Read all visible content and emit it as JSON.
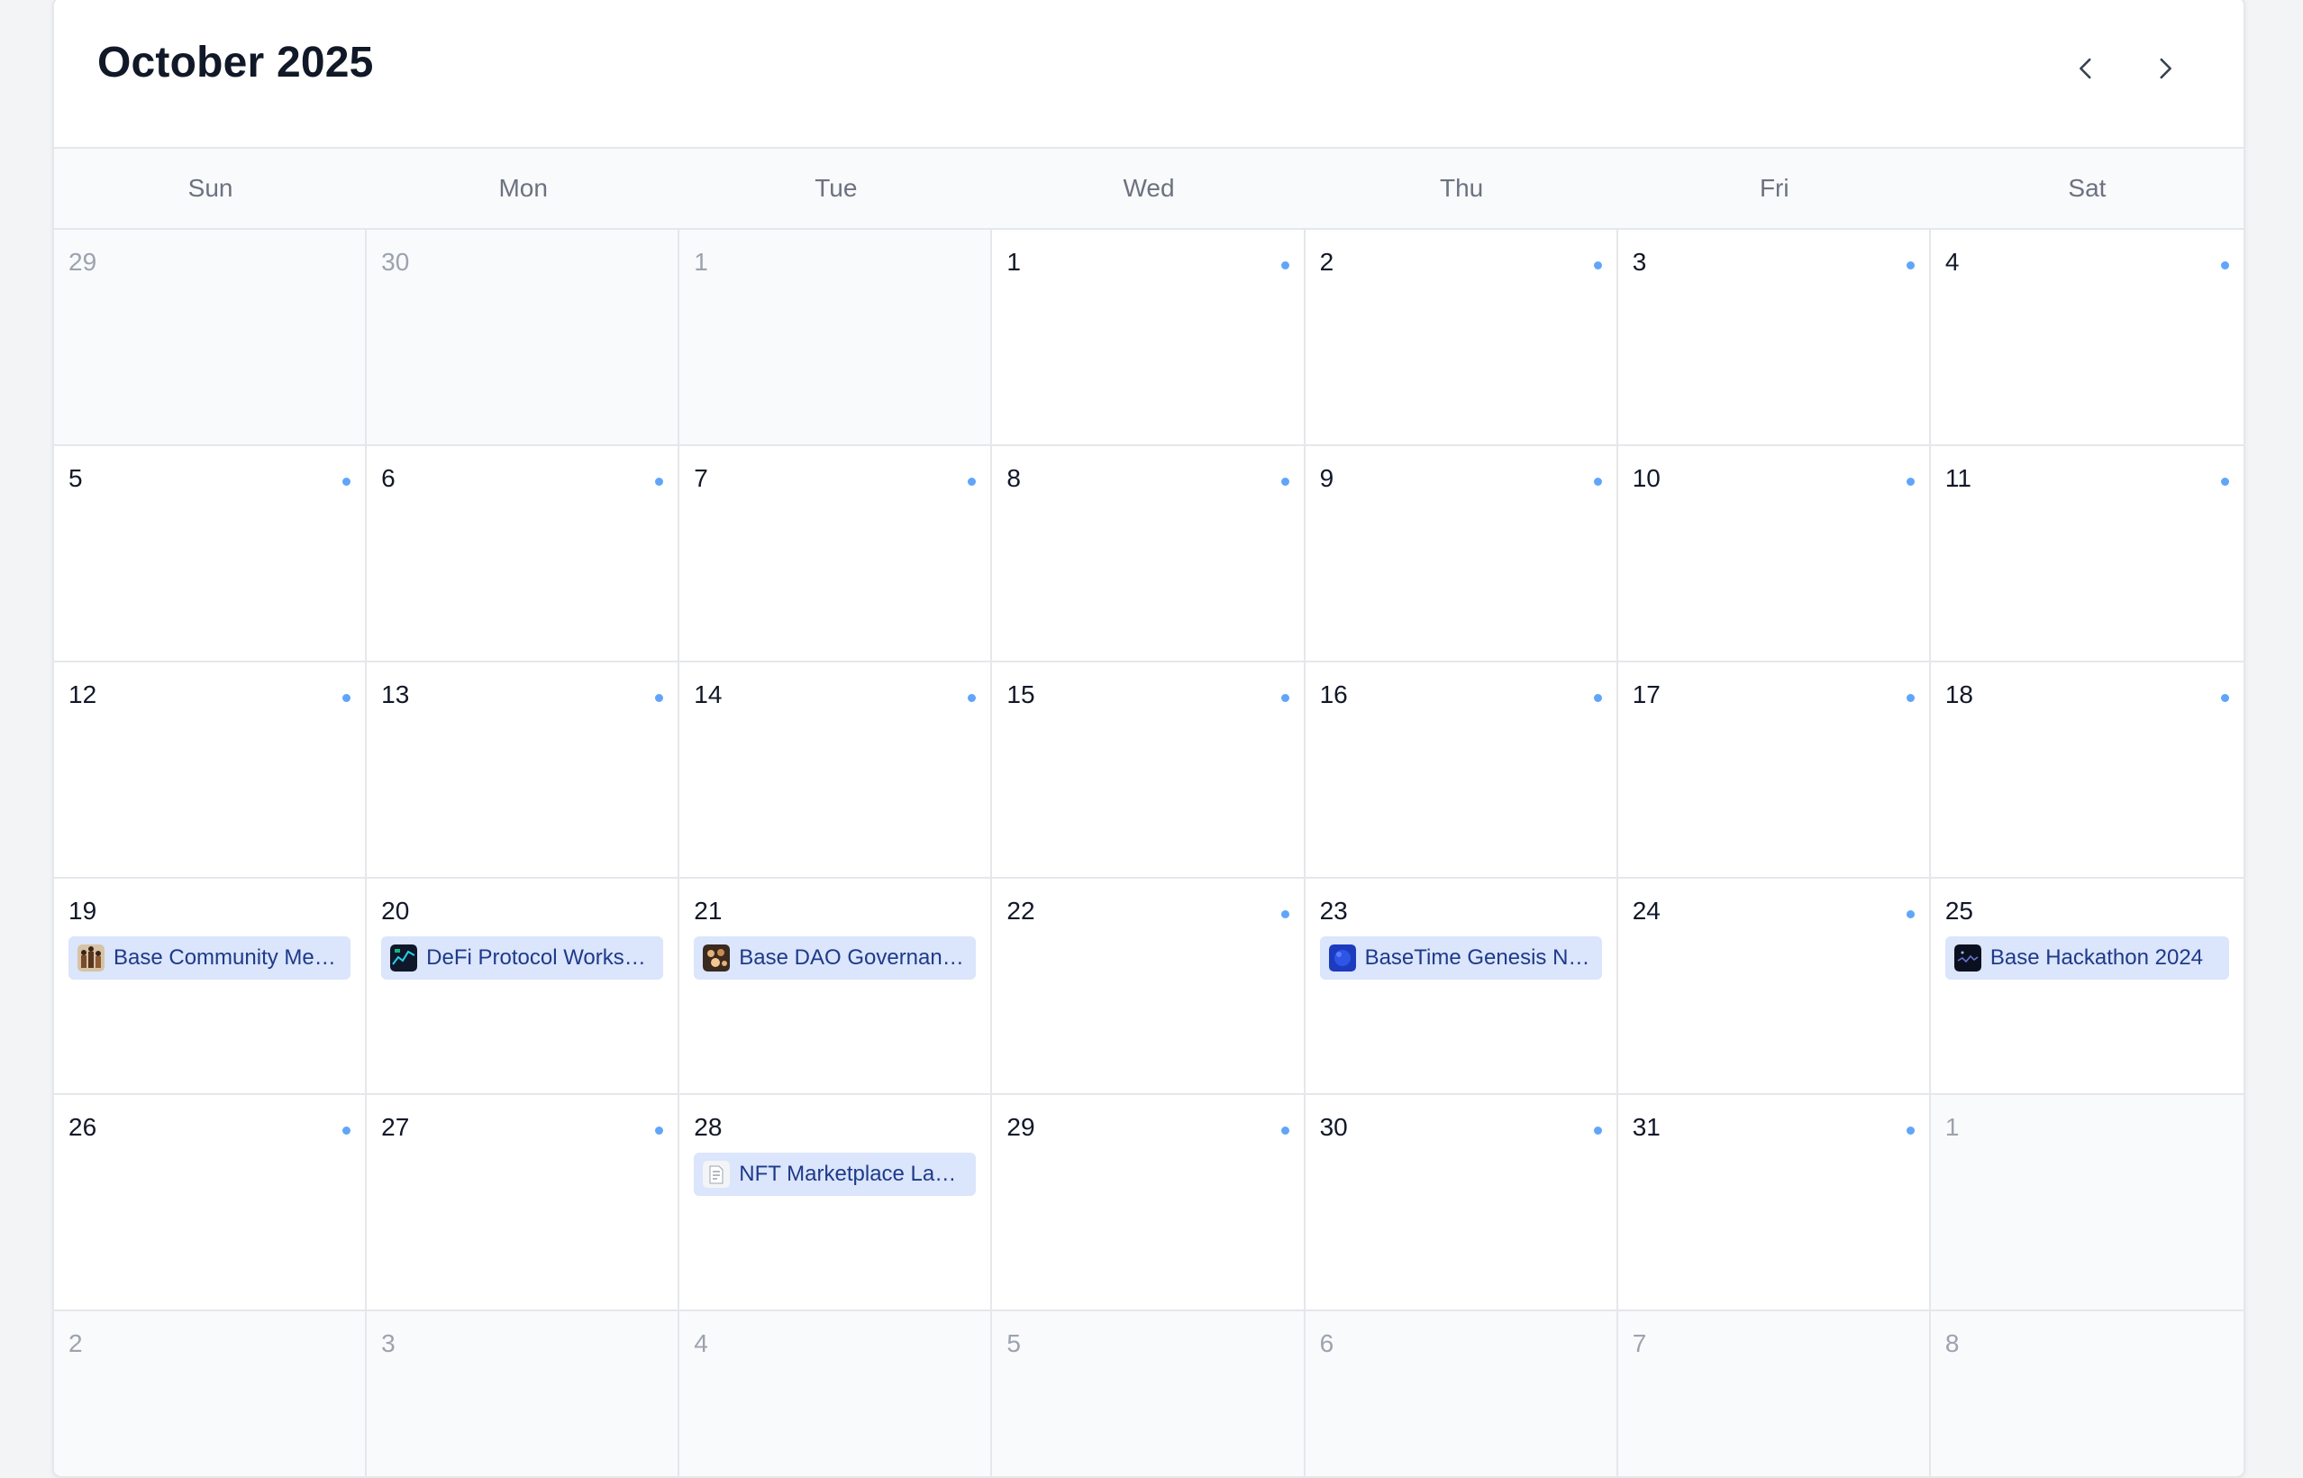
{
  "calendar": {
    "title": "October 2025",
    "nav": {
      "prev_icon": "chevron-left-icon",
      "next_icon": "chevron-right-icon"
    },
    "weekdays": [
      "Sun",
      "Mon",
      "Tue",
      "Wed",
      "Thu",
      "Fri",
      "Sat"
    ],
    "colors": {
      "dot": "#60a5fa",
      "event_bg": "#dbe5fb",
      "event_text": "#1e3a8a",
      "muted_bg": "#f9fafb"
    },
    "days": [
      {
        "label": "29",
        "outside": true
      },
      {
        "label": "30",
        "outside": true
      },
      {
        "label": "1",
        "outside": true
      },
      {
        "label": "1",
        "dot": true
      },
      {
        "label": "2",
        "dot": true
      },
      {
        "label": "3",
        "dot": true
      },
      {
        "label": "4",
        "dot": true
      },
      {
        "label": "5",
        "dot": true
      },
      {
        "label": "6",
        "dot": true
      },
      {
        "label": "7",
        "dot": true
      },
      {
        "label": "8",
        "dot": true
      },
      {
        "label": "9",
        "dot": true
      },
      {
        "label": "10",
        "dot": true
      },
      {
        "label": "11",
        "dot": true
      },
      {
        "label": "12",
        "dot": true
      },
      {
        "label": "13",
        "dot": true
      },
      {
        "label": "14",
        "dot": true
      },
      {
        "label": "15",
        "dot": true
      },
      {
        "label": "16",
        "dot": true
      },
      {
        "label": "17",
        "dot": true
      },
      {
        "label": "18",
        "dot": true
      },
      {
        "label": "19",
        "event": {
          "title": "Base Community Me…",
          "thumb": "community"
        }
      },
      {
        "label": "20",
        "event": {
          "title": "DeFi Protocol Works…",
          "thumb": "defi"
        }
      },
      {
        "label": "21",
        "event": {
          "title": "Base DAO Governan…",
          "thumb": "dao"
        }
      },
      {
        "label": "22",
        "dot": true
      },
      {
        "label": "23",
        "event": {
          "title": "BaseTime Genesis N…",
          "thumb": "genesis"
        }
      },
      {
        "label": "24",
        "dot": true
      },
      {
        "label": "25",
        "event": {
          "title": "Base Hackathon 2024",
          "thumb": "hackathon"
        }
      },
      {
        "label": "26",
        "dot": true
      },
      {
        "label": "27",
        "dot": true
      },
      {
        "label": "28",
        "event": {
          "title": "NFT Marketplace Lau…",
          "thumb": "nft"
        }
      },
      {
        "label": "29",
        "dot": true
      },
      {
        "label": "30",
        "dot": true
      },
      {
        "label": "31",
        "dot": true
      },
      {
        "label": "1",
        "outside": true
      },
      {
        "label": "2",
        "outside": true
      },
      {
        "label": "3",
        "outside": true
      },
      {
        "label": "4",
        "outside": true
      },
      {
        "label": "5",
        "outside": true
      },
      {
        "label": "6",
        "outside": true
      },
      {
        "label": "7",
        "outside": true
      },
      {
        "label": "8",
        "outside": true
      }
    ]
  }
}
